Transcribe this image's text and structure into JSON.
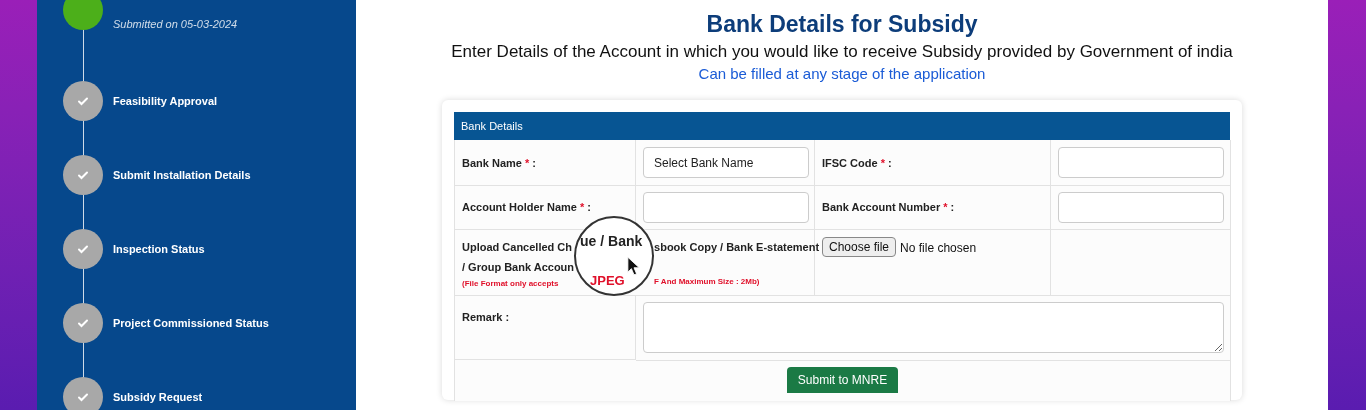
{
  "sidebar": {
    "steps": [
      {
        "kind": "completed",
        "subtitle": "Submitted on 05-03-2024"
      },
      {
        "kind": "pending",
        "label": "Feasibility Approval"
      },
      {
        "kind": "pending",
        "label": "Submit Installation Details"
      },
      {
        "kind": "pending",
        "label": "Inspection Status"
      },
      {
        "kind": "pending",
        "label": "Project Commissioned Status"
      },
      {
        "kind": "pending",
        "label": "Subsidy Request"
      }
    ]
  },
  "page": {
    "title": "Bank Details for Subsidy",
    "subtitle": "Enter Details of the Account in which you would like to receive Subsidy provided by Government of india",
    "note": "Can be filled at any stage of the application"
  },
  "form": {
    "header": "Bank Details",
    "fields": [
      {
        "label": "Bank Name",
        "marker": "*",
        "suffix": ":",
        "kind": "select",
        "placeholder": "Select Bank Name"
      },
      {
        "label": "IFSC Code",
        "marker": "*",
        "suffix": ":",
        "kind": "text"
      },
      {
        "label": "Account Holder Name",
        "marker": "*",
        "suffix": ":",
        "kind": "text"
      },
      {
        "label": "Bank Account Number",
        "marker": "*",
        "suffix": ":",
        "kind": "text"
      }
    ],
    "upload": {
      "label_start": "Upload Cancelled Ch",
      "label_end": "sbook Copy / Bank E-statement",
      "label_line2": "/ Group Bank Accoun",
      "hint_start": "(File Format only accepts",
      "hint_end": "F And Maximum Size : 2Mb)",
      "button": "Choose file",
      "status": "No file chosen"
    },
    "remark": {
      "label": "Remark :"
    },
    "submit": "Submit to MNRE"
  },
  "magnifier": {
    "text": "ue / Bank",
    "hint": "JPEG"
  }
}
